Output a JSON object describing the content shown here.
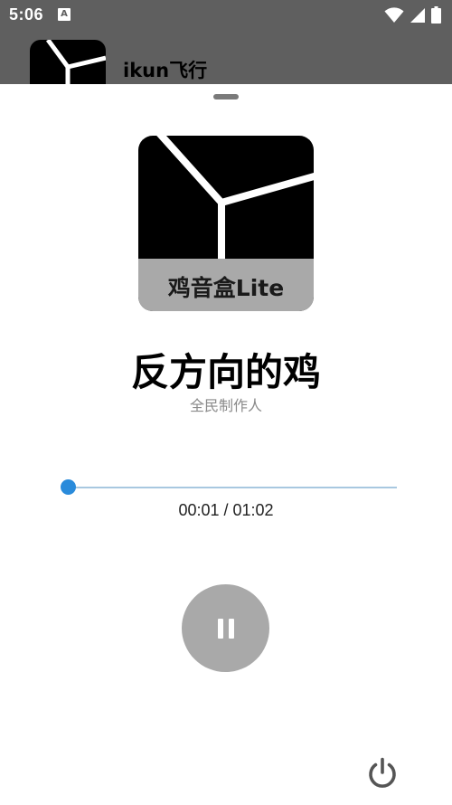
{
  "status_bar": {
    "time": "5:06",
    "notification_icon": "A"
  },
  "background_app": {
    "title": "ikun飞行"
  },
  "player": {
    "album_label": "鸡音盒Lite",
    "song_title": "反方向的鸡",
    "artist": "全民制作人",
    "time_readout": "00:01 / 01:02",
    "progress": 0.016,
    "state_icon": "pause-icon",
    "power_icon": "power-icon"
  },
  "colors": {
    "accent": "#2a8bdb",
    "track": "#a8c8e0",
    "button_bg": "#a9a9a9",
    "scrim": "#5f5f5f"
  }
}
